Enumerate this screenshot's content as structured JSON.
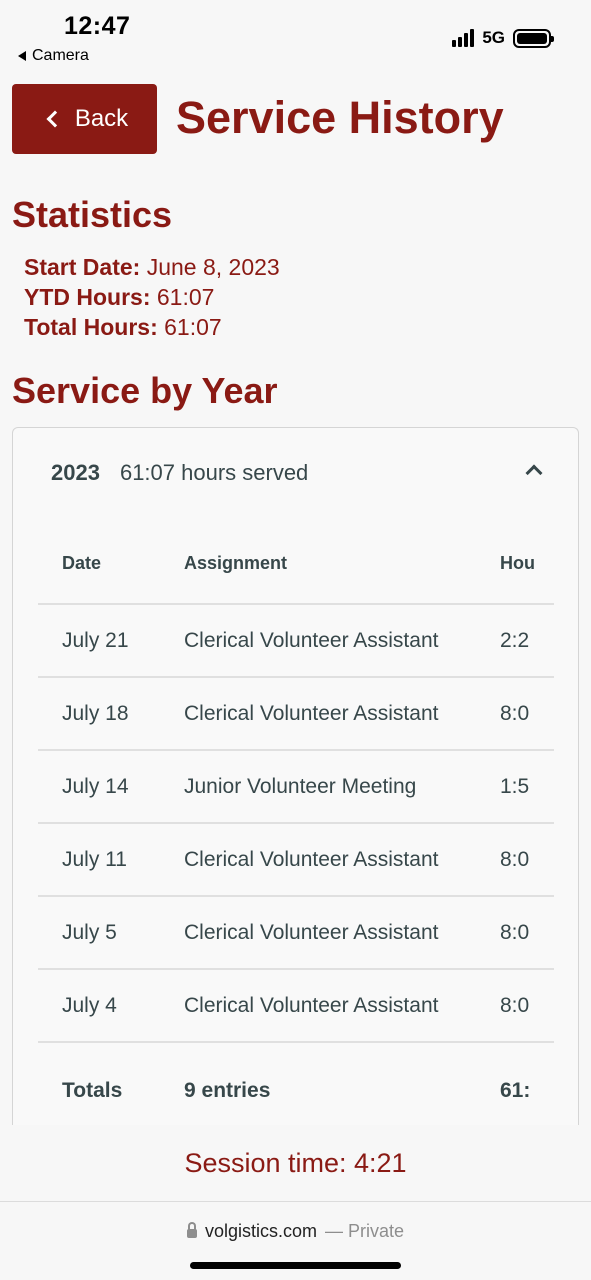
{
  "status": {
    "time": "12:47",
    "back_app": "Camera",
    "network": "5G"
  },
  "header": {
    "back_label": "Back",
    "title": "Service History"
  },
  "statistics": {
    "heading": "Statistics",
    "start_date_label": "Start Date:",
    "start_date_value": "June 8, 2023",
    "ytd_label": "YTD Hours:",
    "ytd_value": "61:07",
    "total_label": "Total Hours:",
    "total_value": "61:07"
  },
  "service_by_year": {
    "heading": "Service by Year",
    "year": "2023",
    "year_hours": "61:07 hours served",
    "columns": [
      "Date",
      "Assignment",
      "Hou"
    ],
    "rows": [
      {
        "date": "July 21",
        "assignment": "Clerical Volunteer Assistant",
        "hours": "2:2"
      },
      {
        "date": "July 18",
        "assignment": "Clerical Volunteer Assistant",
        "hours": "8:0"
      },
      {
        "date": "July 14",
        "assignment": "Junior Volunteer Meeting",
        "hours": "1:5"
      },
      {
        "date": "July 11",
        "assignment": "Clerical Volunteer Assistant",
        "hours": "8:0"
      },
      {
        "date": "July 5",
        "assignment": "Clerical Volunteer Assistant",
        "hours": "8:0"
      },
      {
        "date": "July 4",
        "assignment": "Clerical Volunteer Assistant",
        "hours": "8:0"
      }
    ],
    "totals": {
      "label": "Totals",
      "entries": "9 entries",
      "hours": "61:"
    }
  },
  "session": "Session time: 4:21",
  "browser": {
    "domain": "volgistics.com",
    "private": "— Private"
  }
}
